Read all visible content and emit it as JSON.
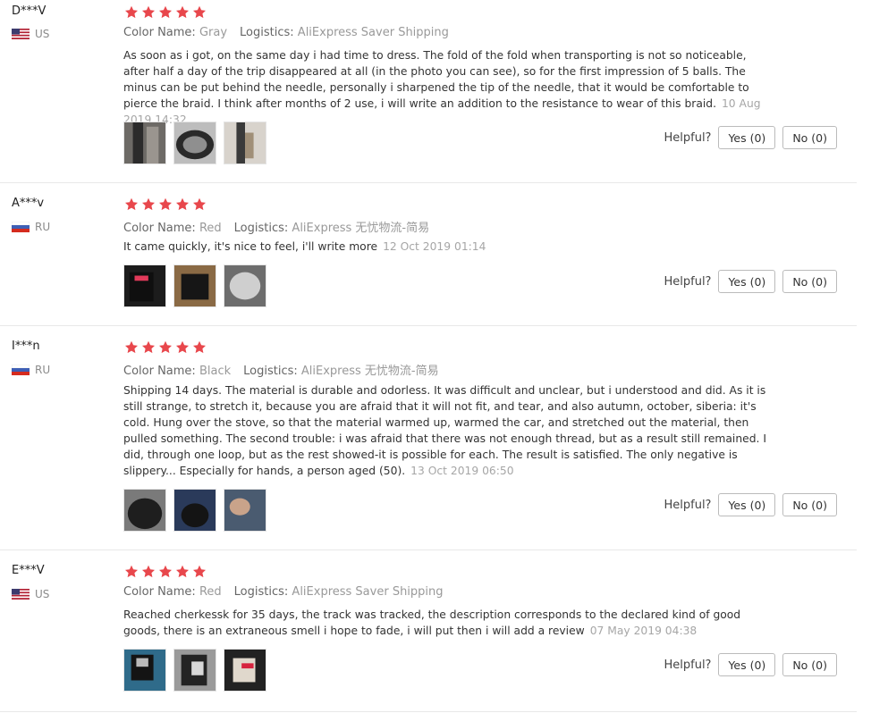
{
  "labels": {
    "color_name": "Color Name:",
    "logistics": "Logistics:",
    "helpful": "Helpful?",
    "yes": "Yes (0)",
    "no": "No (0)"
  },
  "colors": {
    "star": "#e8474c",
    "flag_us_red": "#b22234",
    "flag_us_blue": "#3c3b6e",
    "flag_ru_blue": "#3e5fb5",
    "flag_ru_red": "#d52b1e"
  },
  "reviews": [
    {
      "user": "D***V",
      "country": "US",
      "rating": 5,
      "color_name": "Gray",
      "logistics": "AliExpress Saver Shipping",
      "text": "As soon as i got, on the same day i had time to dress. The fold of the fold when transporting is not so noticeable, after half a day of the trip disappeared at all (in the photo you can see), so for the first impression of 5 balls. The minus can be put behind the needle, personally i sharpened the tip of the needle, that it would be comfortable to pierce the braid. I think after months of 2 use, i will write an addition to the resistance to wear of this braid.",
      "date": "10 Aug 2019 14:32"
    },
    {
      "user": "A***v",
      "country": "RU",
      "rating": 5,
      "color_name": "Red",
      "logistics": "AliExpress 无忧物流-简易",
      "text": "It came quickly, it's nice to feel, i'll write more",
      "date": "12 Oct 2019 01:14"
    },
    {
      "user": "I***n",
      "country": "RU",
      "rating": 5,
      "color_name": "Black",
      "logistics": "AliExpress 无忧物流-简易",
      "text": "Shipping 14 days. The material is durable and odorless. It was difficult and unclear, but i understood and did. As it is still strange, to stretch it, because you are afraid that it will not fit, and tear, and also autumn, october, siberia: it's cold. Hung over the stove, so that the material warmed up, warmed the car, and stretched out the material, then pulled something. The second trouble: i was afraid that there was not enough thread, but as a result still remained. I did, through one loop, but as the rest showed-it is possible for each. The result is satisfied. The only negative is slippery... Especially for hands, a person aged (50).",
      "date": "13 Oct 2019 06:50"
    },
    {
      "user": "E***V",
      "country": "US",
      "rating": 5,
      "color_name": "Red",
      "logistics": "AliExpress Saver Shipping",
      "text": "Reached cherkessk for 35 days, the track was tracked, the description corresponds to the declared kind of good goods, there is an extraneous smell i hope to fade, i will put then i will add a review",
      "date": "07 May 2019 04:38"
    }
  ]
}
